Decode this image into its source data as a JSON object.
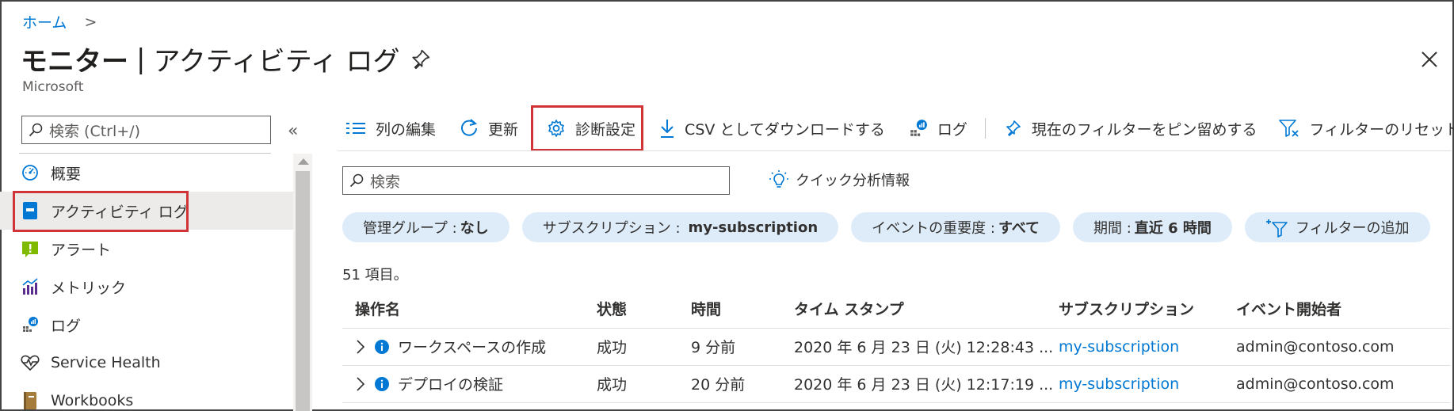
{
  "breadcrumb": {
    "home": "ホーム",
    "separator": ">"
  },
  "header": {
    "title_prefix": "モニター",
    "title_separator": "|",
    "title_page": "アクティビティ ログ",
    "subtitle": "Microsoft",
    "pin_icon": "pin-icon",
    "close_icon": "close-icon"
  },
  "sidebar": {
    "search_placeholder": "検索 (Ctrl+/)",
    "collapse_glyph": "«",
    "items": [
      {
        "label": "概要",
        "icon": "gauge-icon"
      },
      {
        "label": "アクティビティ ログ",
        "icon": "activity-log-icon",
        "active": true
      },
      {
        "label": "アラート",
        "icon": "alert-icon"
      },
      {
        "label": "メトリック",
        "icon": "metrics-icon"
      },
      {
        "label": "ログ",
        "icon": "logs-icon"
      },
      {
        "label": "Service Health",
        "icon": "heart-pulse-icon"
      },
      {
        "label": "Workbooks",
        "icon": "workbook-icon"
      }
    ]
  },
  "toolbar": {
    "edit_columns": "列の編集",
    "refresh": "更新",
    "diagnostic_settings": "診断設定",
    "download_csv": "CSV としてダウンロードする",
    "logs": "ログ",
    "pin_filters": "現在のフィルターをピン留めする",
    "reset_filters": "フィルターのリセット"
  },
  "search": {
    "placeholder": "検索"
  },
  "insights": {
    "label": "クイック分析情報"
  },
  "filters": [
    {
      "label": "管理グループ :",
      "value": "なし"
    },
    {
      "label": "サブスクリプション :",
      "value": "my-subscription"
    },
    {
      "label": "イベントの重要度 :",
      "value": "すべて"
    },
    {
      "label": "期間 :",
      "value": "直近 6 時間"
    }
  ],
  "add_filter": "フィルターの追加",
  "count": "51 項目。",
  "table": {
    "headers": [
      "操作名",
      "状態",
      "時間",
      "タイム スタンプ",
      "サブスクリプション",
      "イベント開始者"
    ],
    "rows": [
      {
        "operation": "ワークスペースの作成",
        "status": "成功",
        "time": "9 分前",
        "timestamp": "2020 年 6 月 23 日 (火) 12:28:43 ...",
        "subscription": "my-subscription",
        "initiator": "admin@contoso.com"
      },
      {
        "operation": "デプロイの検証",
        "status": "成功",
        "time": "20 分前",
        "timestamp": "2020 年 6 月 23 日 (火) 12:17:19 ...",
        "subscription": "my-subscription",
        "initiator": "admin@contoso.com"
      }
    ]
  },
  "colors": {
    "accent": "#0078d4",
    "highlight": "#d13438",
    "pill": "#deecf9",
    "active_nav": "#edebe9"
  }
}
